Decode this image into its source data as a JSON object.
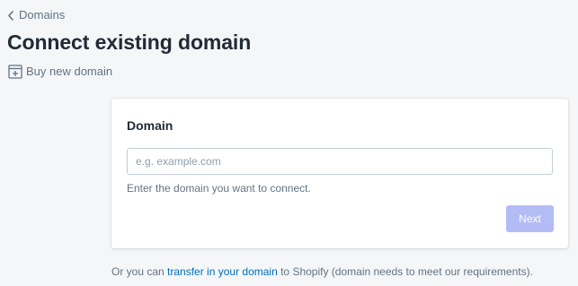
{
  "breadcrumb": {
    "label": "Domains",
    "icon": "chevron-left-icon"
  },
  "page": {
    "title": "Connect existing domain"
  },
  "secondary_action": {
    "label": "Buy new domain",
    "icon": "buy-domain-icon"
  },
  "card": {
    "title": "Domain",
    "input": {
      "value": "",
      "placeholder": "e.g. example.com"
    },
    "help_text": "Enter the domain you want to connect.",
    "next_button": {
      "label": "Next",
      "state": "disabled"
    }
  },
  "footer": {
    "prefix": "Or you can ",
    "link_text": "transfer in your domain",
    "suffix": " to Shopify (domain needs to meet our requirements)."
  },
  "colors": {
    "background": "#f4f6f8",
    "card": "#ffffff",
    "text": "#212b36",
    "subdued_text": "#637381",
    "link": "#006fbb",
    "disabled_primary": "#b3bcf5"
  }
}
